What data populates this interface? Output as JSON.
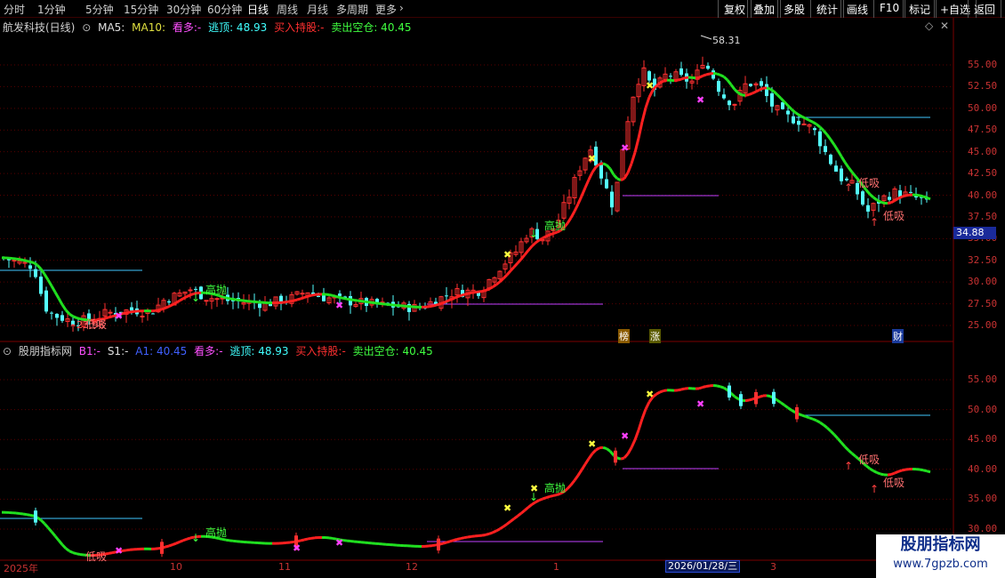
{
  "toolbar": {
    "periods": [
      "分时",
      "1分钟",
      "5分钟",
      "15分钟",
      "30分钟",
      "60分钟",
      "日线",
      "周线",
      "月线",
      "多周期",
      "更多"
    ],
    "active_period": "日线",
    "more_arrow": "›",
    "right_buttons": [
      "复权",
      "叠加",
      "多股",
      "统计",
      "画线",
      "F10",
      "标记",
      "+自选",
      "返回"
    ]
  },
  "main": {
    "stock_name": "航发科技(日线)",
    "ma5_label": "MA5:",
    "ma10_label": "MA10:",
    "kanduo": "看多:-",
    "taoding": "逃顶: 48.93",
    "mairu": "买入持股:-",
    "maichu": "卖出空仓: 40.45",
    "diamond_icon": "◇",
    "close_icon": "✕",
    "high_label": "58.31",
    "current_price": "34.88",
    "y_ticks": [
      "55.00",
      "52.50",
      "50.00",
      "47.50",
      "45.00",
      "42.50",
      "40.00",
      "37.50",
      "35.00",
      "32.50",
      "30.00",
      "27.50",
      "25.00"
    ],
    "annotations": {
      "gaopao": "高抛",
      "dixi": "低吸",
      "low_label": "23.98"
    },
    "tags": [
      "榜",
      "涨",
      "财"
    ]
  },
  "indicator": {
    "name": "股朋指标网",
    "b1": "B1:-",
    "s1": "S1:-",
    "a1": "A1: 40.45",
    "kanduo": "看多:-",
    "taoding": "逃顶: 48.93",
    "mairu": "买入持股:-",
    "maichu": "卖出空仓: 40.45",
    "y_ticks": [
      "55.00",
      "50.00",
      "45.00",
      "40.00",
      "35.00",
      "30.00"
    ],
    "annotations": {
      "gaopao": "高抛",
      "dixi": "低吸"
    }
  },
  "xaxis": {
    "labels": [
      "2025年",
      "10",
      "11",
      "12",
      "1",
      "3"
    ],
    "cursor_date": "2026/01/28/三"
  },
  "watermark": {
    "title": "股朋指标网",
    "url": "www.7gpzb.com"
  },
  "colors": {
    "up": "#ff3030",
    "down": "#54ffff",
    "ma_up": "#ff2020",
    "ma_down": "#20e020",
    "bg": "#000000",
    "grid": "#7a0000"
  }
}
